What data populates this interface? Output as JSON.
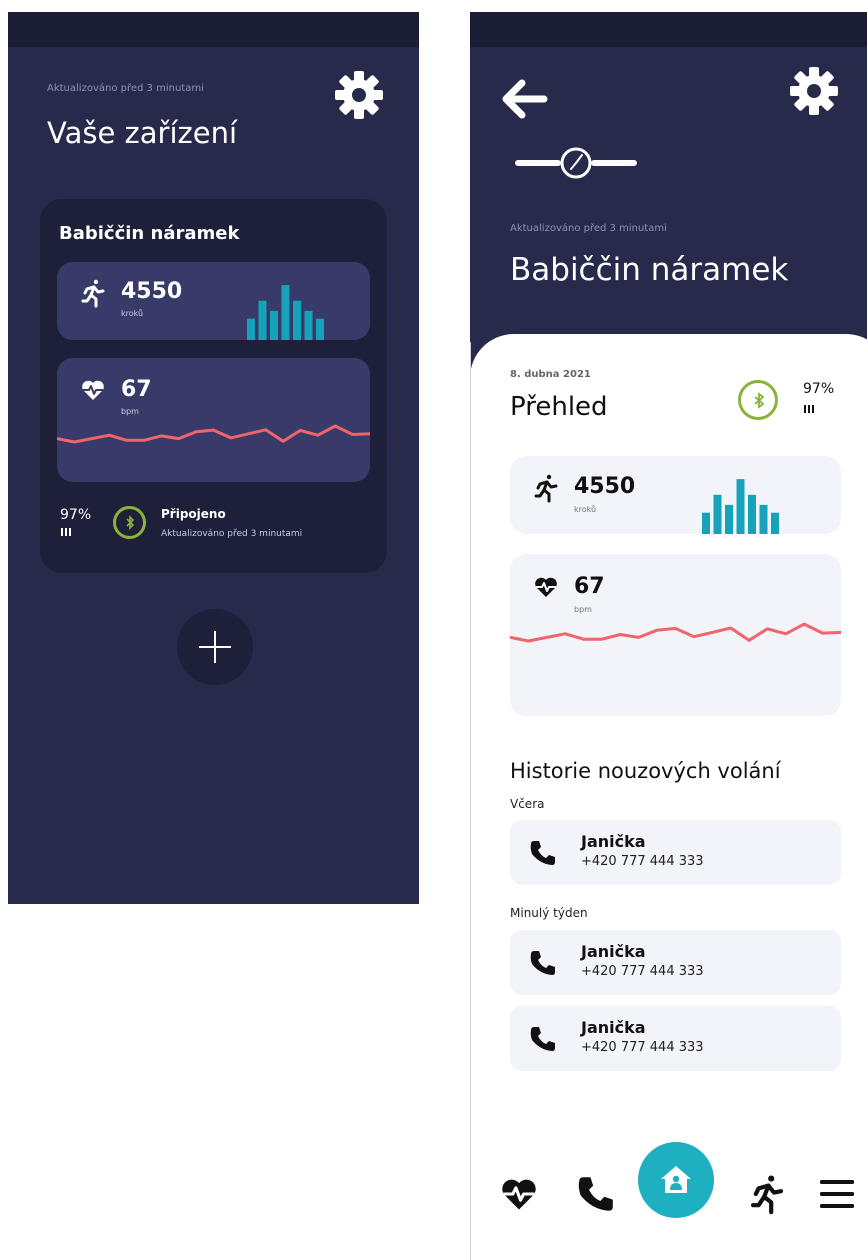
{
  "colors": {
    "background_dark": "#272a4b",
    "card_dark": "#1e2039",
    "panel_dark": "#383b69",
    "steps_bars": "#16a2bb",
    "heart_line": "#f0646b",
    "bluetooth_green": "#8ab33a",
    "home_button": "#1eafc0"
  },
  "devices_screen": {
    "updated_text": "Aktualizováno před 3 minutami",
    "title": "Vaše zařízení",
    "settings_icon": "gear-icon",
    "device_card": {
      "name": "Babiččin náramek",
      "steps": {
        "icon": "running-icon",
        "value": "4550",
        "unit": "kroků",
        "bars": [
          0.38,
          0.7,
          0.52,
          0.98,
          0.7,
          0.52,
          0.38
        ]
      },
      "heart": {
        "icon": "heart-pulse-icon",
        "value": "67",
        "unit": "bpm",
        "trend": [
          0.6,
          0.5,
          0.6,
          0.7,
          0.55,
          0.55,
          0.68,
          0.6,
          0.8,
          0.85,
          0.62,
          0.74,
          0.86,
          0.52,
          0.84,
          0.7,
          0.97,
          0.72,
          0.74
        ]
      },
      "battery_percent": "97%",
      "battery_icon": "battery-bars-icon",
      "status_icon": "bluetooth-icon",
      "status": "Připojeno",
      "status_updated": "Aktualizováno před 3 minutami"
    },
    "add_button_icon": "plus-icon"
  },
  "detail_screen": {
    "back_icon": "arrow-left-icon",
    "settings_icon": "gear-icon",
    "device_icon": "watch-icon",
    "updated_text": "Aktualizováno před 3 minutami",
    "title": "Babiččin náramek",
    "date": "8. dubna 2021",
    "overview_title": "Přehled",
    "battery_percent": "97%",
    "steps": {
      "value": "4550",
      "unit": "kroků"
    },
    "heart": {
      "value": "67",
      "unit": "bpm"
    },
    "emergency_title": "Historie nouzových volání",
    "call_groups": [
      {
        "label": "Včera",
        "calls": [
          {
            "name": "Janička",
            "number": "+420 777 444 333"
          }
        ]
      },
      {
        "label": "Minulý týden",
        "calls": [
          {
            "name": "Janička",
            "number": "+420 777 444 333"
          },
          {
            "name": "Janička",
            "number": "+420 777 444 333"
          }
        ]
      }
    ],
    "bottom_nav": [
      "heart-pulse-icon",
      "phone-icon",
      "home-icon",
      "running-icon",
      "menu-icon"
    ]
  }
}
